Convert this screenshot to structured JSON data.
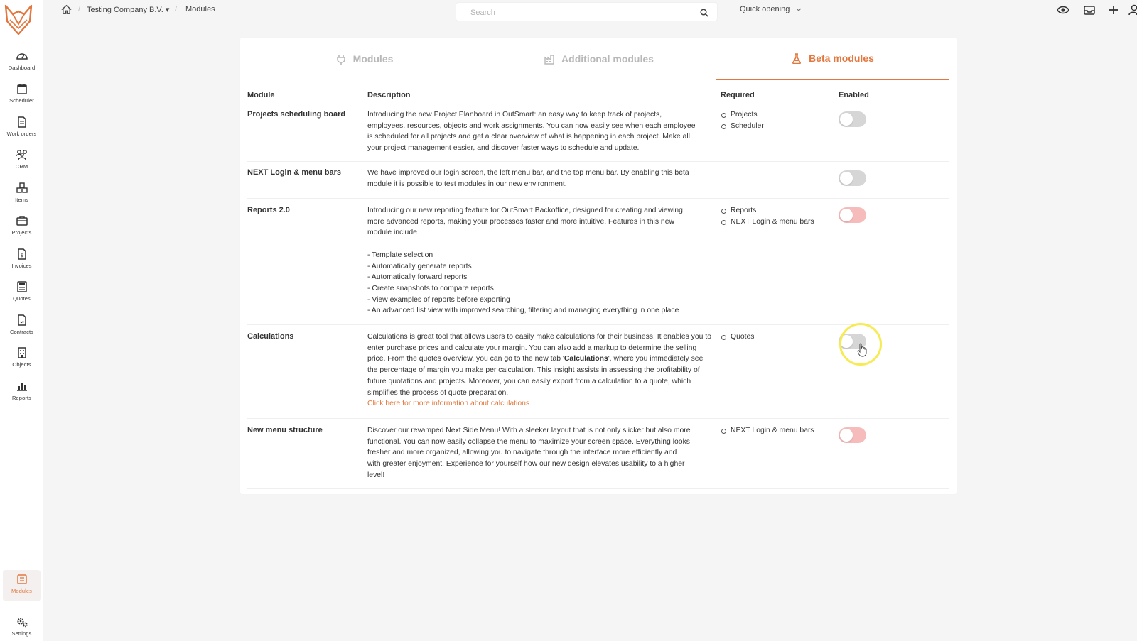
{
  "sidebar": {
    "items": [
      {
        "id": "dashboard",
        "label": "Dashboard",
        "icon": "gauge-icon"
      },
      {
        "id": "scheduler",
        "label": "Scheduler",
        "icon": "calendar-icon"
      },
      {
        "id": "work-orders",
        "label": "Work orders",
        "icon": "document-icon"
      },
      {
        "id": "crm",
        "label": "CRM",
        "icon": "people-icon"
      },
      {
        "id": "items",
        "label": "Items",
        "icon": "boxes-icon"
      },
      {
        "id": "projects",
        "label": "Projects",
        "icon": "briefcase-icon"
      },
      {
        "id": "invoices",
        "label": "Invoices",
        "icon": "invoice-icon"
      },
      {
        "id": "quotes",
        "label": "Quotes",
        "icon": "calculator-icon"
      },
      {
        "id": "contracts",
        "label": "Contracts",
        "icon": "contract-icon"
      },
      {
        "id": "objects",
        "label": "Objects",
        "icon": "building-icon"
      },
      {
        "id": "reports",
        "label": "Reports",
        "icon": "bar-chart-icon"
      }
    ],
    "bottom_items": [
      {
        "id": "modules",
        "label": "Modules",
        "icon": "modules-icon",
        "active": true
      },
      {
        "id": "settings",
        "label": "Settings",
        "icon": "gears-icon"
      }
    ]
  },
  "topbar": {
    "breadcrumb": {
      "company": "Testing Company B.V. ▾",
      "page": "Modules"
    },
    "search_placeholder": "Search",
    "quick_opening": "Quick opening"
  },
  "tabs": [
    {
      "label": "Modules",
      "icon": "plug-icon",
      "active": false
    },
    {
      "label": "Additional modules",
      "icon": "factory-icon",
      "active": false
    },
    {
      "label": "Beta modules",
      "icon": "flask-icon",
      "active": true
    }
  ],
  "table": {
    "headers": {
      "module": "Module",
      "description": "Description",
      "required": "Required",
      "enabled": "Enabled"
    },
    "rows": [
      {
        "name": "Projects scheduling board",
        "description": [
          "Introducing the new Project Planboard in OutSmart: an easy way to keep track of projects,",
          "employees, resources, objects and work assignments. You can now easily see when each employee",
          "is scheduled for all projects and get a clear overview of what is happening in each project. Make all",
          "your project management easier, and discover faster ways to schedule and update."
        ],
        "required": [
          "Projects",
          "Scheduler"
        ],
        "enabled": false
      },
      {
        "name": "NEXT Login & menu bars",
        "description": [
          "We have improved our login screen, the left menu bar, and the top menu bar. By enabling this beta",
          "module it is possible to test modules in our new environment."
        ],
        "required": [],
        "enabled": false
      },
      {
        "name": "Reports 2.0",
        "description": [
          "Introducing our new reporting feature for OutSmart Backoffice, designed for creating and viewing",
          "more advanced reports, making your processes faster and more intuitive. Features in this new",
          "module include",
          "",
          "- Template selection",
          "- Automatically generate reports",
          "- Automatically forward reports",
          "- Create snapshots to compare reports",
          "- View examples of reports before exporting",
          "- An advanced list view with improved searching, filtering and managing everything in one place"
        ],
        "required": [
          "Reports",
          "NEXT Login & menu bars"
        ],
        "enabled": true
      },
      {
        "name": "Calculations",
        "description_pre": "Calculations is great tool that allows users to easily make calculations for their business. It enables you to enter purchase prices and calculate your margin. You can also add a markup to determine the selling price. From the quotes overview, you can go to the new tab '",
        "description_bold": "Calculations",
        "description_post": "', where you immediately see the percentage of margin you make per calculation. This insight assists in assessing the profitability of future quotations and projects. Moreover, you can easily export from a calculation to a quote, which simplifies the process of quote preparation.",
        "link": "Click here for more information about calculations",
        "required": [
          "Quotes"
        ],
        "enabled": false
      },
      {
        "name": "New menu structure",
        "description": [
          "Discover our revamped Next Side Menu! With a sleeker layout that is not only slicker but also more",
          "functional. You can now easily collapse the menu to maximize your screen space. Everything looks",
          "fresher and more organized, allowing you to navigate through the interface more efficiently and",
          "with greater enjoyment. Experience for yourself how our new design elevates usability to a higher",
          "level!"
        ],
        "required": [
          "NEXT Login & menu bars"
        ],
        "enabled": true
      }
    ]
  },
  "colors": {
    "accent": "#e2783f",
    "toggle_on": "#f6bcbc",
    "toggle_off": "#d6d6d6",
    "highlight": "#f6ec52"
  }
}
